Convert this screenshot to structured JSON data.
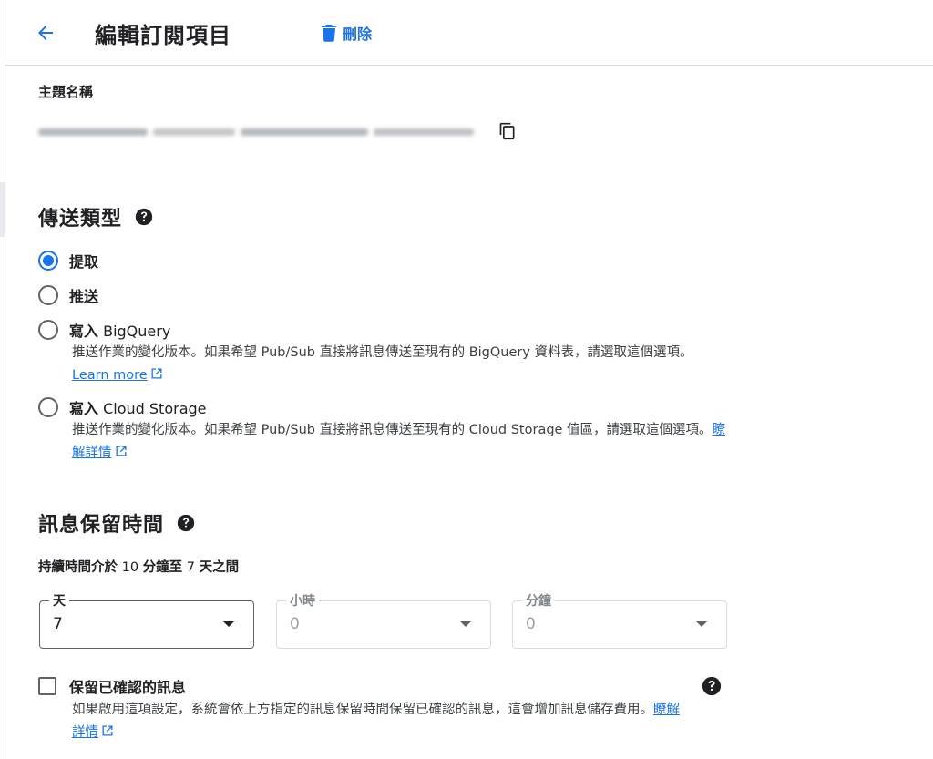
{
  "header": {
    "title": "編輯訂閱項目",
    "delete_label": "刪除"
  },
  "topic": {
    "label": "主題名稱"
  },
  "delivery": {
    "heading": "傳送類型",
    "options": [
      {
        "label": "提取",
        "selected": true
      },
      {
        "label": "推送",
        "selected": false
      },
      {
        "label_bold": "寫入",
        "label_rest": " BigQuery",
        "selected": false,
        "desc": "推送作業的變化版本。如果希望 Pub/Sub 直接將訊息傳送至現有的 BigQuery 資料表，請選取這個選項。",
        "link": "Learn more"
      },
      {
        "label_bold": "寫入",
        "label_rest": " Cloud Storage",
        "selected": false,
        "desc": "推送作業的變化版本。如果希望 Pub/Sub 直接將訊息傳送至現有的 Cloud Storage 值區，請選取這個選項。",
        "link": "瞭解詳情"
      }
    ]
  },
  "retention": {
    "heading": "訊息保留時間",
    "hint_a": "持續時間介於",
    "hint_b": " 10 ",
    "hint_c": "分鐘至",
    "hint_d": " 7 ",
    "hint_e": "天之間",
    "days": {
      "label": "天",
      "value": "7"
    },
    "hours": {
      "label": "小時",
      "value": "0"
    },
    "minutes": {
      "label": "分鐘",
      "value": "0"
    }
  },
  "retain_acked": {
    "label": "保留已確認的訊息",
    "checked": false,
    "desc": "如果啟用這項設定，系統會依上方指定的訊息保留時間保留已確認的訊息，這會增加訊息儲存費用。",
    "link": "瞭解詳情"
  },
  "colors": {
    "accent": "#1a73e8",
    "text": "#202124",
    "border": "#dadce0"
  }
}
